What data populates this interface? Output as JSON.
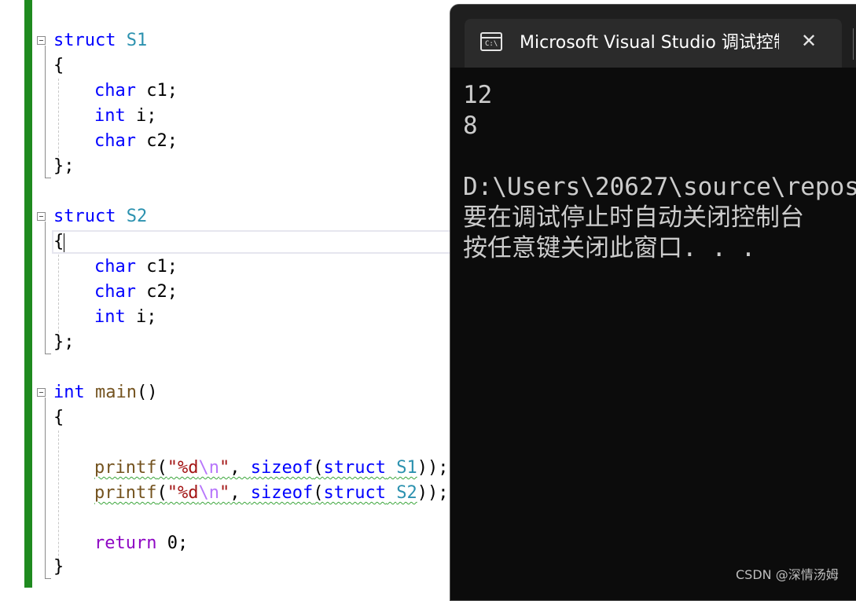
{
  "editor": {
    "lines": {
      "s1_struct_kw": "struct",
      "s1_name": "S1",
      "s1_open": "{",
      "s1_m1_type": "char",
      "s1_m1_rest": " c1;",
      "s1_m2_type": "int",
      "s1_m2_rest": " i;",
      "s1_m3_type": "char",
      "s1_m3_rest": " c2;",
      "s1_close": "};",
      "s2_struct_kw": "struct",
      "s2_name": "S2",
      "s2_open": "{",
      "s2_m1_type": "char",
      "s2_m1_rest": " c1;",
      "s2_m2_type": "char",
      "s2_m2_rest": " c2;",
      "s2_m3_type": "int",
      "s2_m3_rest": " i;",
      "s2_close": "};",
      "main_ret_type": "int",
      "main_name": "main",
      "main_parens": "()",
      "main_open": "{",
      "p1_fn": "printf",
      "p1_lp": "(",
      "p1_str_a": "\"%d",
      "p1_esc": "\\n",
      "p1_str_b": "\"",
      "p1_comma": ", ",
      "p1_sizeof": "sizeof",
      "p1_lp2": "(",
      "p1_struct": "struct",
      "p1_sp": " ",
      "p1_type": "S1",
      "p1_end": "));",
      "p2_fn": "printf",
      "p2_lp": "(",
      "p2_str_a": "\"%d",
      "p2_esc": "\\n",
      "p2_str_b": "\"",
      "p2_comma": ", ",
      "p2_sizeof": "sizeof",
      "p2_lp2": "(",
      "p2_struct": "struct",
      "p2_sp": " ",
      "p2_type": "S2",
      "p2_end": "));",
      "return_kw": "return",
      "return_rest": " 0;",
      "main_close": "}"
    }
  },
  "console": {
    "title": "Microsoft Visual Studio 调试控制台",
    "icon_text": "C:\\",
    "close_glyph": "✕",
    "output": [
      "12",
      "8",
      "",
      "D:\\Users\\20627\\source\\repos",
      "要在调试停止时自动关闭控制台",
      "按任意键关闭此窗口. . ."
    ]
  },
  "watermark": "CSDN @深情汤姆",
  "colors": {
    "keyword": "#0000ff",
    "control_keyword": "#8f08c4",
    "type_name": "#2b91af",
    "function": "#74531f",
    "string": "#a31515",
    "escape": "#b776fb",
    "change_bar": "#1f8a1f",
    "console_bg": "#0c0c0c"
  }
}
